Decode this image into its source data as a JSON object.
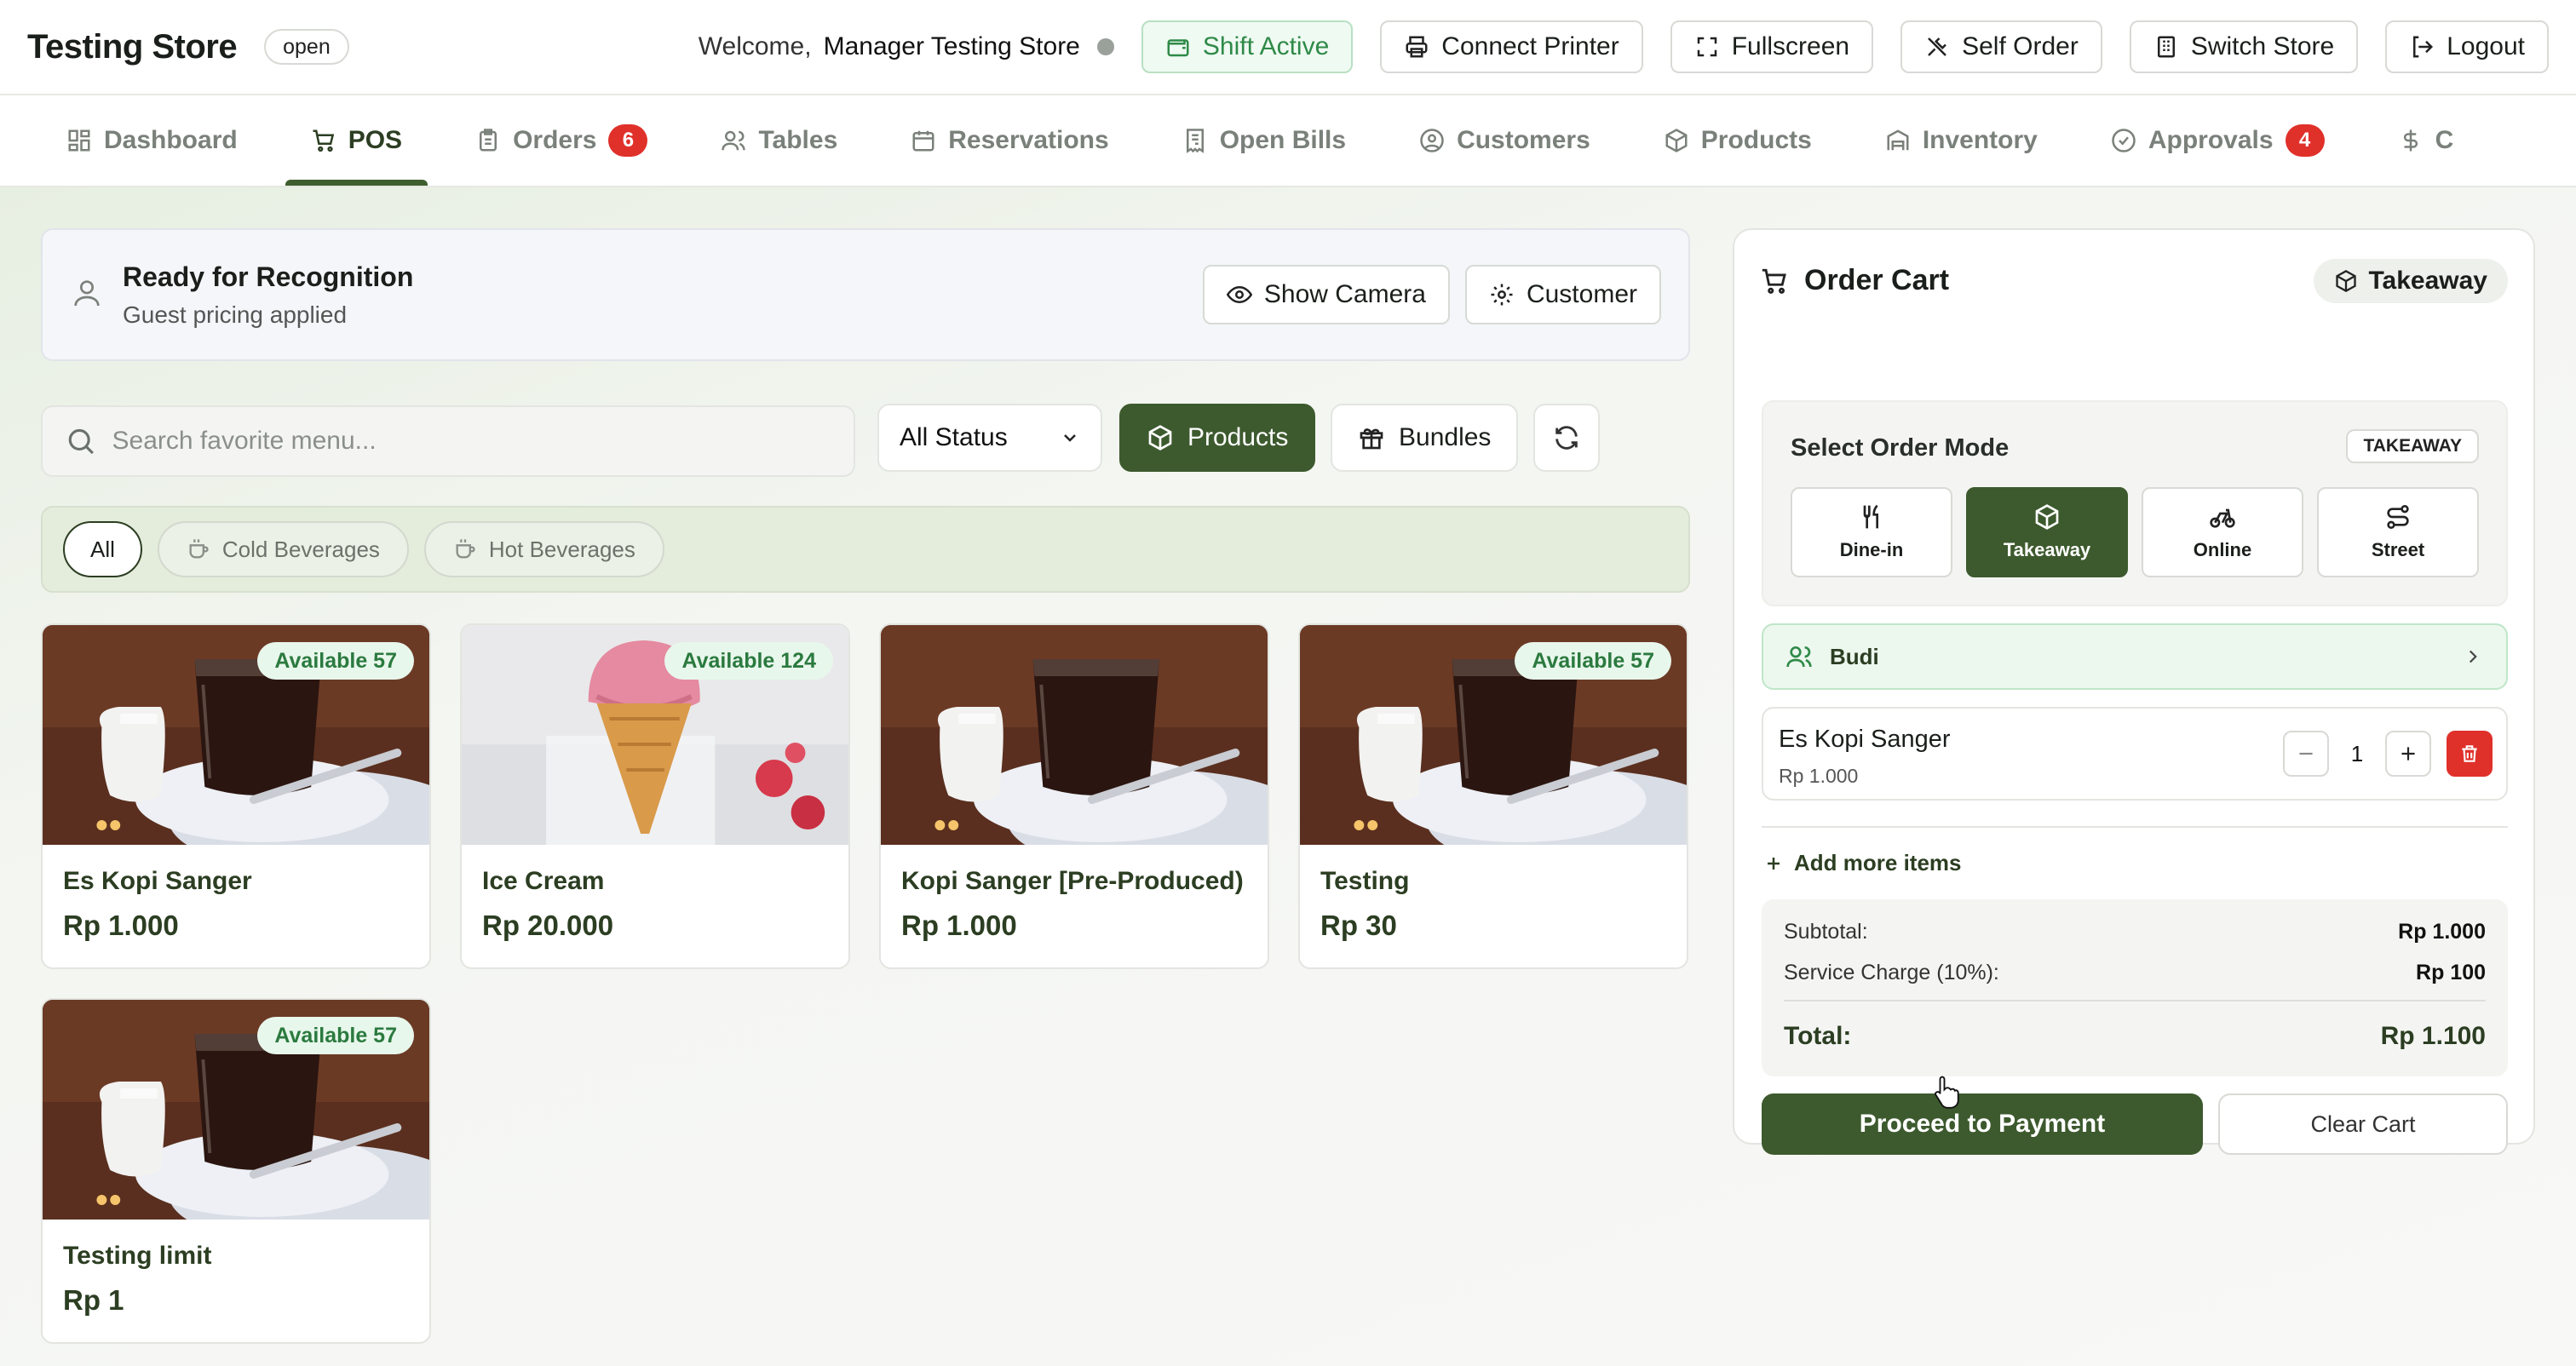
{
  "header": {
    "store_title": "Testing Store",
    "store_status": "open",
    "welcome_label": "Welcome,",
    "user_name": "Manager Testing Store",
    "buttons": {
      "shift": "Shift Active",
      "printer": "Connect Printer",
      "fullscreen": "Fullscreen",
      "self_order": "Self Order",
      "switch_store": "Switch Store",
      "logout": "Logout"
    }
  },
  "nav": {
    "tabs": [
      {
        "label": "Dashboard",
        "icon": "grid-icon"
      },
      {
        "label": "POS",
        "icon": "cart-icon",
        "active": true
      },
      {
        "label": "Orders",
        "icon": "clipboard-icon",
        "badge": "6"
      },
      {
        "label": "Tables",
        "icon": "users-icon"
      },
      {
        "label": "Reservations",
        "icon": "calendar-icon"
      },
      {
        "label": "Open Bills",
        "icon": "receipt-icon"
      },
      {
        "label": "Customers",
        "icon": "user-circle-icon"
      },
      {
        "label": "Products",
        "icon": "box-icon"
      },
      {
        "label": "Inventory",
        "icon": "warehouse-icon"
      },
      {
        "label": "Approvals",
        "icon": "check-circle-icon",
        "badge": "4"
      },
      {
        "label": "C",
        "icon": "dollar-icon"
      }
    ]
  },
  "recognition": {
    "title": "Ready for Recognition",
    "subtitle": "Guest pricing applied",
    "show_camera": "Show Camera",
    "customer": "Customer"
  },
  "filters": {
    "search_placeholder": "Search favorite menu...",
    "status_selected": "All Status",
    "products_label": "Products",
    "bundles_label": "Bundles",
    "categories": [
      "All",
      "Cold Beverages",
      "Hot Beverages"
    ]
  },
  "products": [
    {
      "name": "Es Kopi Sanger",
      "price": "Rp 1.000",
      "availability": "Available 57",
      "image": "coffee"
    },
    {
      "name": "Ice Cream",
      "price": "Rp 20.000",
      "availability": "Available 124",
      "image": "icecream"
    },
    {
      "name": "Kopi Sanger [Pre-Produced)",
      "price": "Rp 1.000",
      "availability": "",
      "image": "coffee"
    },
    {
      "name": "Testing",
      "price": "Rp 30",
      "availability": "Available 57",
      "image": "coffee"
    },
    {
      "name": "Testing limit",
      "price": "Rp 1",
      "availability": "Available 57",
      "image": "coffee"
    }
  ],
  "cart": {
    "title": "Order Cart",
    "mode_pill": "Takeaway",
    "mode_title": "Select Order Mode",
    "mode_tag": "TAKEAWAY",
    "modes": [
      "Dine-in",
      "Takeaway",
      "Online",
      "Street"
    ],
    "customer_name": "Budi",
    "item": {
      "name": "Es Kopi Sanger",
      "price": "Rp 1.000",
      "qty": "1"
    },
    "add_more": "Add more items",
    "subtotal_label": "Subtotal:",
    "subtotal_value": "Rp 1.000",
    "service_label": "Service Charge (10%):",
    "service_value": "Rp 100",
    "total_label": "Total:",
    "total_value": "Rp 1.100",
    "pay_button": "Proceed to Payment",
    "clear_button": "Clear Cart"
  },
  "colors": {
    "brand": "#3d5a2e",
    "badge_red": "#e0302a",
    "available_green": "#2b7a3f"
  }
}
